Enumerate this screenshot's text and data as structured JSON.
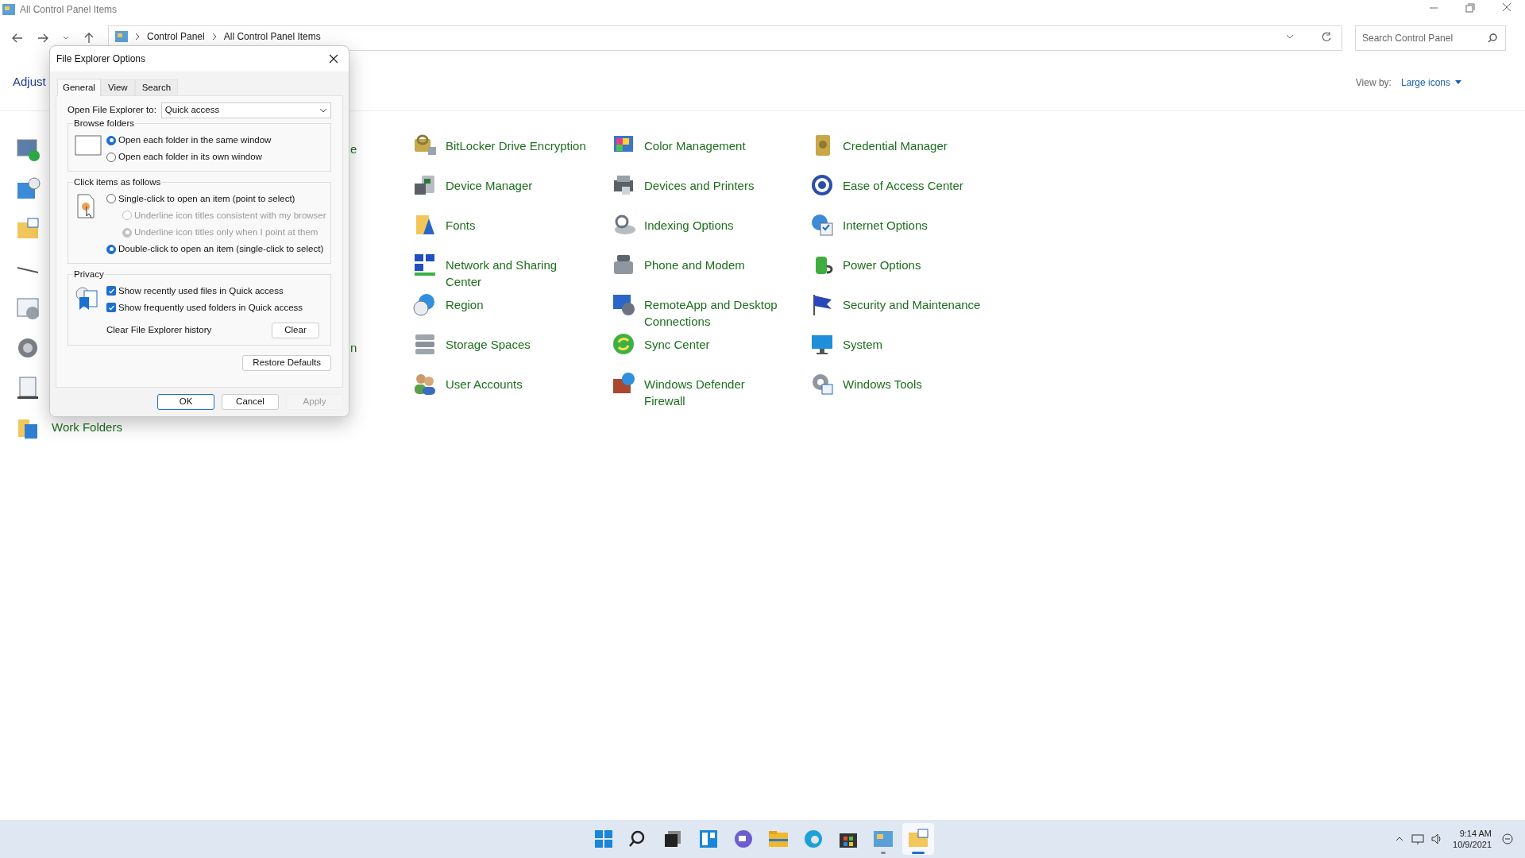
{
  "window": {
    "title": "All Control Panel Items"
  },
  "address": {
    "segments": [
      "Control Panel",
      "All Control Panel Items"
    ]
  },
  "search": {
    "placeholder": "Search Control Panel"
  },
  "heading": "Adjust",
  "view_by": {
    "label": "View by:",
    "value": "Large icons"
  },
  "left_column": {
    "partial_labels": [
      "e",
      "n"
    ],
    "work_folders": "Work Folders"
  },
  "items": [
    {
      "label": "BitLocker Drive Encryption"
    },
    {
      "label": "Color Management"
    },
    {
      "label": "Credential Manager"
    },
    {
      "label": "Device Manager"
    },
    {
      "label": "Devices and Printers"
    },
    {
      "label": "Ease of Access Center"
    },
    {
      "label": "Fonts"
    },
    {
      "label": "Indexing Options"
    },
    {
      "label": "Internet Options"
    },
    {
      "label": "Network and Sharing Center"
    },
    {
      "label": "Phone and Modem"
    },
    {
      "label": "Power Options"
    },
    {
      "label": "Region"
    },
    {
      "label": "RemoteApp and Desktop Connections"
    },
    {
      "label": "Security and Maintenance"
    },
    {
      "label": "Storage Spaces"
    },
    {
      "label": "Sync Center"
    },
    {
      "label": "System"
    },
    {
      "label": "User Accounts"
    },
    {
      "label": "Windows Defender Firewall"
    },
    {
      "label": "Windows Tools"
    }
  ],
  "dialog": {
    "title": "File Explorer Options",
    "tabs": [
      {
        "label": "General",
        "selected": true
      },
      {
        "label": "View",
        "selected": false
      },
      {
        "label": "Search",
        "selected": false
      }
    ],
    "open_to": {
      "label": "Open File Explorer to:",
      "value": "Quick access"
    },
    "groups": [
      {
        "title": "Browse folders",
        "options": [
          {
            "kind": "radio",
            "label": "Open each folder in the same window",
            "checked": true,
            "disabled": false
          },
          {
            "kind": "radio",
            "label": "Open each folder in its own window",
            "checked": false,
            "disabled": false
          }
        ]
      },
      {
        "title": "Click items as follows",
        "options": [
          {
            "kind": "radio",
            "label": "Single-click to open an item (point to select)",
            "checked": false,
            "disabled": false,
            "children": [
              {
                "kind": "radio",
                "label": "Underline icon titles consistent with my browser",
                "checked": false,
                "disabled": true
              },
              {
                "kind": "radio",
                "label": "Underline icon titles only when I point at them",
                "checked": true,
                "disabled": true
              }
            ]
          },
          {
            "kind": "radio",
            "label": "Double-click to open an item (single-click to select)",
            "checked": true,
            "disabled": false
          }
        ]
      },
      {
        "title": "Privacy",
        "options": [
          {
            "kind": "checkbox",
            "label": "Show recently used files in Quick access",
            "checked": true,
            "disabled": false
          },
          {
            "kind": "checkbox",
            "label": "Show frequently used folders in Quick access",
            "checked": true,
            "disabled": false
          },
          {
            "kind": "action",
            "label": "Clear File Explorer history",
            "button": "Clear"
          }
        ]
      }
    ],
    "restore": "Restore Defaults",
    "buttons": [
      {
        "label": "OK",
        "disabled": false,
        "default": true
      },
      {
        "label": "Cancel",
        "disabled": false,
        "default": false
      },
      {
        "label": "Apply",
        "disabled": true,
        "default": false
      }
    ]
  },
  "taskbar": {
    "apps": [
      {
        "running": false,
        "selected": false
      },
      {
        "running": false,
        "selected": false
      },
      {
        "running": false,
        "selected": false
      },
      {
        "running": false,
        "selected": false
      },
      {
        "running": false,
        "selected": false
      },
      {
        "running": false,
        "selected": false
      },
      {
        "running": false,
        "selected": false
      },
      {
        "running": false,
        "selected": false
      },
      {
        "running": true,
        "selected": false
      },
      {
        "running": true,
        "selected": true
      }
    ],
    "time": "9:14 AM",
    "date": "10/9/2021"
  }
}
